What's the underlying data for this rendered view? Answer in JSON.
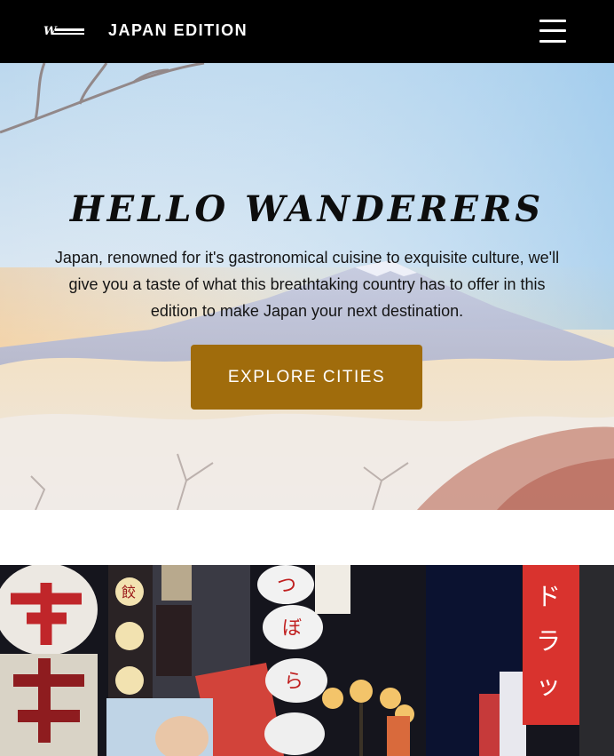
{
  "header": {
    "logo_icon": "wanderer-logo-icon",
    "title": "JAPAN EDITION",
    "menu_icon": "hamburger-menu-icon"
  },
  "hero": {
    "title": "HELLO WANDERERS",
    "description": "Japan, renowned for it's gastronomical cuisine to exquisite culture, we'll give you a taste of what this breathtaking country has to offer in this edition to make Japan your next destination.",
    "cta_label": "EXPLORE CITIES",
    "background_image": "mount-fuji-sunrise-image"
  },
  "city_image": {
    "image": "osaka-dotonbori-night-image"
  },
  "colors": {
    "header_bg": "#000000",
    "cta_bg": "#a06c0c",
    "page_bg": "#ffffff"
  }
}
